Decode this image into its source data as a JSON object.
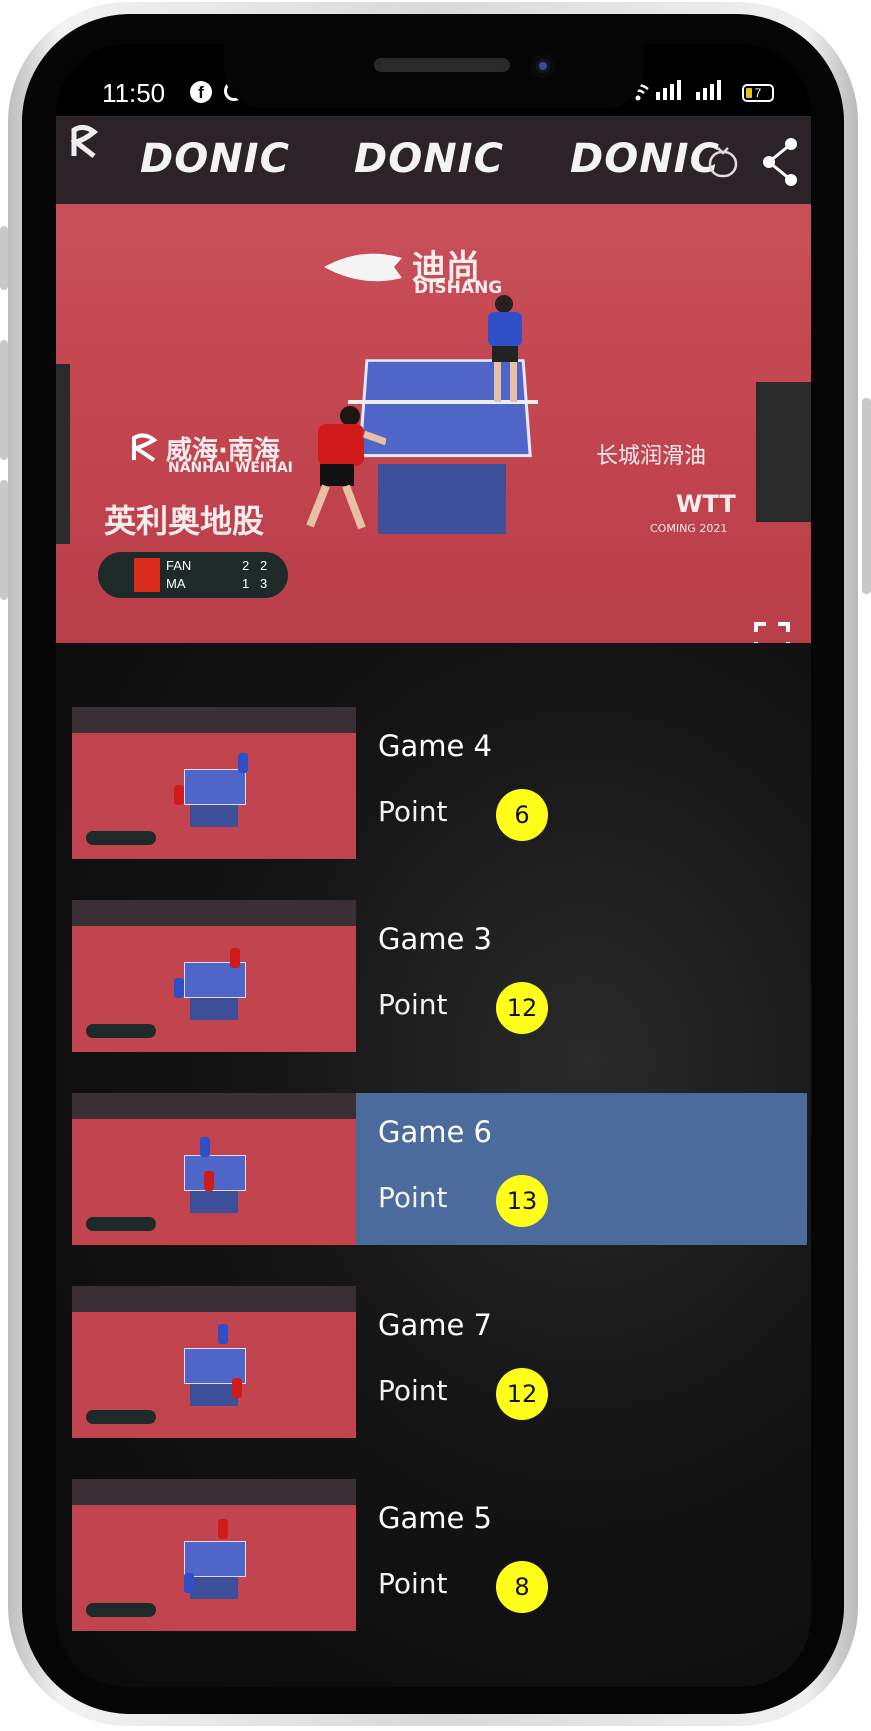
{
  "status": {
    "time": "11:50",
    "battery": "7",
    "fb_glyph": "f"
  },
  "video": {
    "banner_brand": "DONIC",
    "court_sponsor_cn": "迪尚",
    "court_sponsor_en": "DISHANG",
    "sponsor_left_cn": "威海·南海",
    "sponsor_left_en": "NANHAI WEIHAI",
    "sponsor_right_cn": "长城润滑油",
    "court_chinese": "英利奥地股",
    "wtt": "WTT",
    "wtt_sub": "COMING 2021",
    "scoreboard": [
      {
        "name": "FAN",
        "games": "2",
        "points": "2"
      },
      {
        "name": "MA",
        "games": "1",
        "points": "3"
      }
    ]
  },
  "icons": {
    "tv": "tv-icon",
    "share": "share-icon",
    "fullscreen": "fullscreen-icon"
  },
  "clips": [
    {
      "title": "Game 4",
      "point_label": "Point",
      "point": "6",
      "selected": false
    },
    {
      "title": "Game 3",
      "point_label": "Point",
      "point": "12",
      "selected": false
    },
    {
      "title": "Game 6",
      "point_label": "Point",
      "point": "13",
      "selected": true
    },
    {
      "title": "Game 7",
      "point_label": "Point",
      "point": "12",
      "selected": false
    },
    {
      "title": "Game 5",
      "point_label": "Point",
      "point": "8",
      "selected": false
    }
  ],
  "colors": {
    "selected_row": "#4b6b9c",
    "point_badge": "#ffff1a"
  }
}
